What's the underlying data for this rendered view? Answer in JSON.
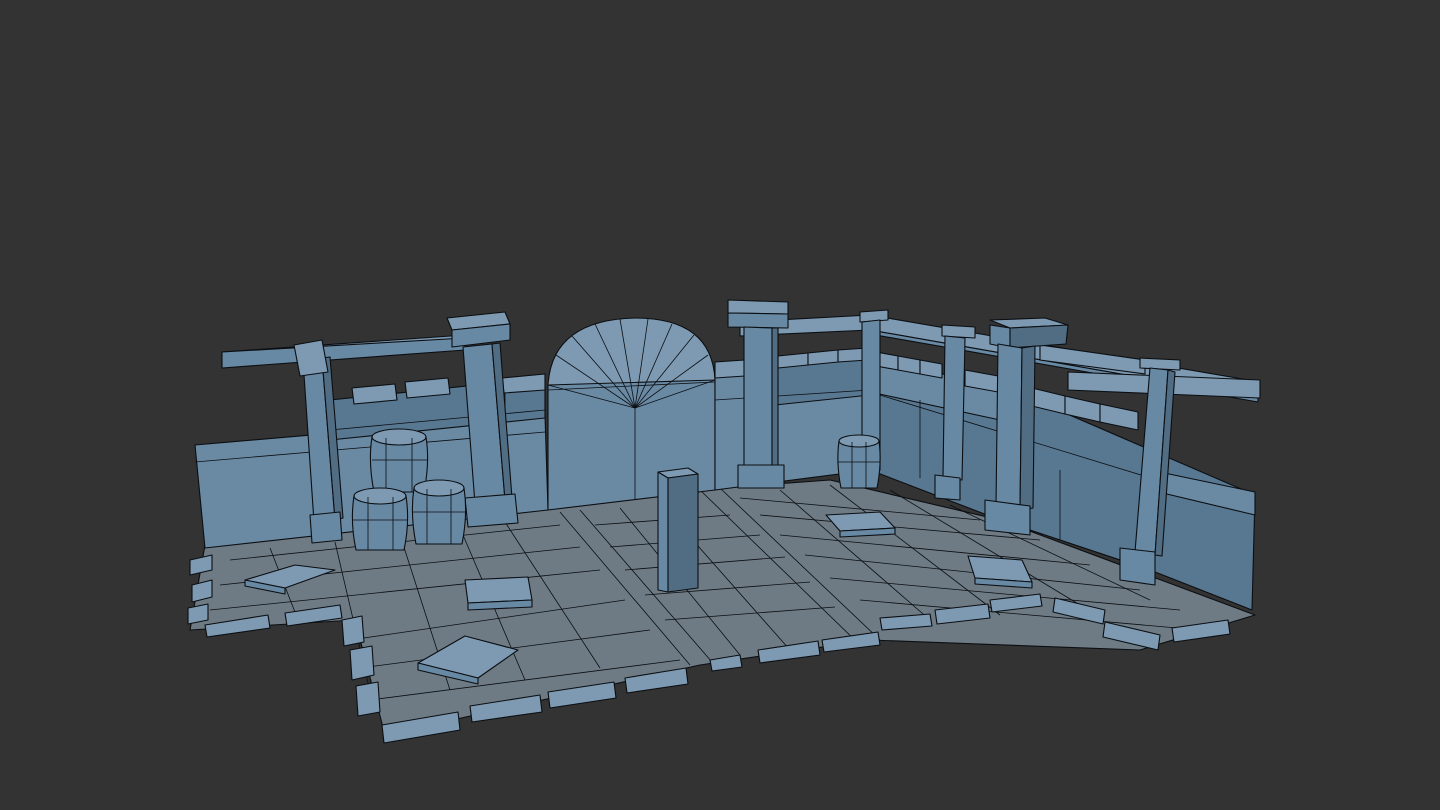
{
  "viewport": {
    "background_color": "#333333",
    "mesh_color": "#6a8aa4",
    "edge_color": "#0b0e12"
  },
  "scene": {
    "objects": [
      "floor-tiles",
      "back-wall-left",
      "back-wall-right",
      "arched-door",
      "pillars",
      "beams",
      "barrels",
      "broken-slabs",
      "center-post"
    ],
    "barrel_count": 4,
    "loose_slab_count": 5
  }
}
